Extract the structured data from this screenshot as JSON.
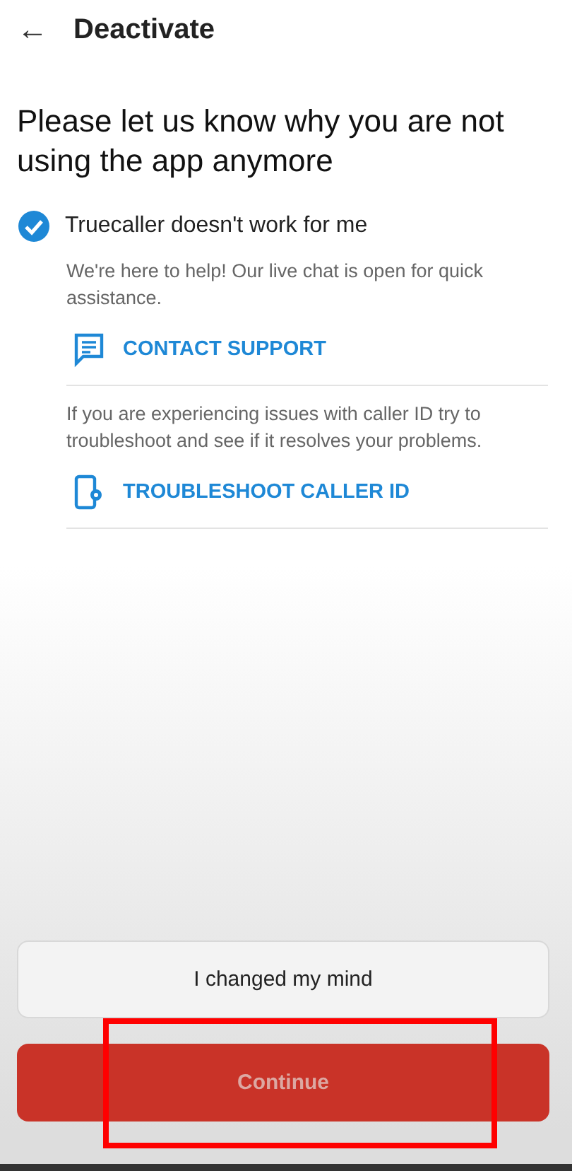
{
  "header": {
    "back": "←",
    "title": "Deactivate"
  },
  "question": "Please let us know why you are not using the app anymore",
  "reasons": [
    {
      "label": "Truecaller doesn't work for me",
      "checked": true,
      "sections": [
        {
          "text": "We're here to help! Our live chat is open for quick assistance.",
          "action": "CONTACT SUPPORT",
          "kind": "chat"
        },
        {
          "text": "If you are experiencing issues with caller ID try to troubleshoot and see if it resolves your problems.",
          "action": "TROUBLESHOOT CALLER ID",
          "kind": "phone"
        }
      ]
    }
  ],
  "buttons": [
    {
      "label": "I changed my mind",
      "kind": "secondary",
      "disabled": false,
      "highlighted": false
    },
    {
      "label": "Continue",
      "kind": "primary",
      "disabled": true,
      "highlighted": true
    }
  ]
}
